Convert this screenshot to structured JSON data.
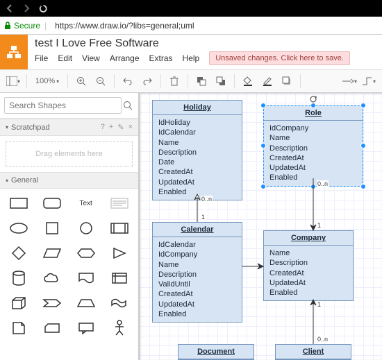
{
  "browser": {
    "secure_label": "Secure",
    "url": "https://www.draw.io/?libs=general;uml"
  },
  "header": {
    "title": "test I Love Free Software",
    "menu": [
      "File",
      "Edit",
      "View",
      "Arrange",
      "Extras",
      "Help"
    ],
    "unsaved": "Unsaved changes. Click here to save."
  },
  "toolbar": {
    "zoom": "100%"
  },
  "sidebar": {
    "search_placeholder": "Search Shapes",
    "scratchpad_label": "Scratchpad",
    "scratchpad_drop": "Drag elements here",
    "general_label": "General",
    "text_shape": "Text"
  },
  "canvas": {
    "entities": {
      "holiday": {
        "title": "Holiday",
        "fields": [
          "IdHoliday",
          "IdCalendar",
          "Name",
          "Description",
          "Date",
          "CreatedAt",
          "UpdatedAt",
          "Enabled"
        ]
      },
      "role": {
        "title": "Role",
        "fields": [
          "IdCompany",
          "Name",
          "Description",
          "CreatedAt",
          "UpdatedAt",
          "Enabled"
        ]
      },
      "calendar": {
        "title": "Calendar",
        "fields": [
          "IdCalendar",
          "IdCompany",
          "Name",
          "Description",
          "ValidUntil",
          "CreatedAt",
          "UpdatedAt",
          "Enabled"
        ]
      },
      "company": {
        "title": "Company",
        "fields": [
          "Name",
          "Description",
          "CreatedAt",
          "UpdatedAt",
          "Enabled"
        ]
      },
      "document": {
        "title": "Document"
      },
      "client": {
        "title": "Client"
      }
    },
    "labels": {
      "zero_n": "0..n",
      "one": "1"
    }
  }
}
